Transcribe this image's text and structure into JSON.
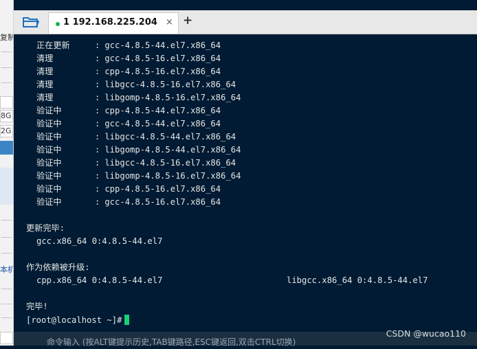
{
  "left_panel": {
    "label_top": "复制",
    "field_a": "8G",
    "field_b": "2G",
    "label_bottom": "本机"
  },
  "tab": {
    "index": "1",
    "title": "192.168.225.204",
    "close": "×",
    "add": "+",
    "status_color": "#19b04b"
  },
  "terminal": {
    "lines": [
      {
        "action": "正在更新",
        "sep": ":",
        "pkg": "gcc-4.8.5-44.el7.x86_64"
      },
      {
        "action": "清理",
        "sep": ":",
        "pkg": "gcc-4.8.5-16.el7.x86_64"
      },
      {
        "action": "清理",
        "sep": ":",
        "pkg": "cpp-4.8.5-16.el7.x86_64"
      },
      {
        "action": "清理",
        "sep": ":",
        "pkg": "libgcc-4.8.5-16.el7.x86_64"
      },
      {
        "action": "清理",
        "sep": ":",
        "pkg": "libgomp-4.8.5-16.el7.x86_64"
      },
      {
        "action": "验证中",
        "sep": ":",
        "pkg": "cpp-4.8.5-44.el7.x86_64"
      },
      {
        "action": "验证中",
        "sep": ":",
        "pkg": "gcc-4.8.5-44.el7.x86_64"
      },
      {
        "action": "验证中",
        "sep": ":",
        "pkg": "libgcc-4.8.5-44.el7.x86_64"
      },
      {
        "action": "验证中",
        "sep": ":",
        "pkg": "libgomp-4.8.5-44.el7.x86_64"
      },
      {
        "action": "验证中",
        "sep": ":",
        "pkg": "libgcc-4.8.5-16.el7.x86_64"
      },
      {
        "action": "验证中",
        "sep": ":",
        "pkg": "libgomp-4.8.5-16.el7.x86_64"
      },
      {
        "action": "验证中",
        "sep": ":",
        "pkg": "cpp-4.8.5-16.el7.x86_64"
      },
      {
        "action": "验证中",
        "sep": ":",
        "pkg": "gcc-4.8.5-16.el7.x86_64"
      }
    ],
    "updated_header": "更新完毕:",
    "updated_pkg": "gcc.x86_64 0:4.8.5-44.el7",
    "deps_header": "作为依赖被升级:",
    "deps_pkg_1": "cpp.x86_64 0:4.8.5-44.el7",
    "deps_pkg_2": "libgcc.x86_64 0:4.8.5-44.el7",
    "done": "完毕!",
    "prompt": "[root@localhost ~]#",
    "cursor_color": "#17d07a"
  },
  "command_bar": {
    "hint": "命令输入 (按ALT键提示历史,TAB键路径,ESC键返回,双击CTRL切换)"
  },
  "watermark": "CSDN @wucao110"
}
